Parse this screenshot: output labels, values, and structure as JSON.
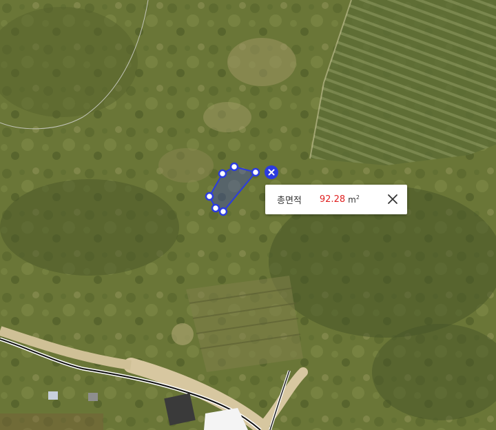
{
  "measurement": {
    "label": "총면적",
    "value": "92.28",
    "unit_base": "m",
    "unit_exp": "2",
    "value_color": "#e02020",
    "shape_color": "#2b3be0"
  },
  "icons": {
    "close": "close-icon",
    "delete": "delete-shape-icon"
  }
}
